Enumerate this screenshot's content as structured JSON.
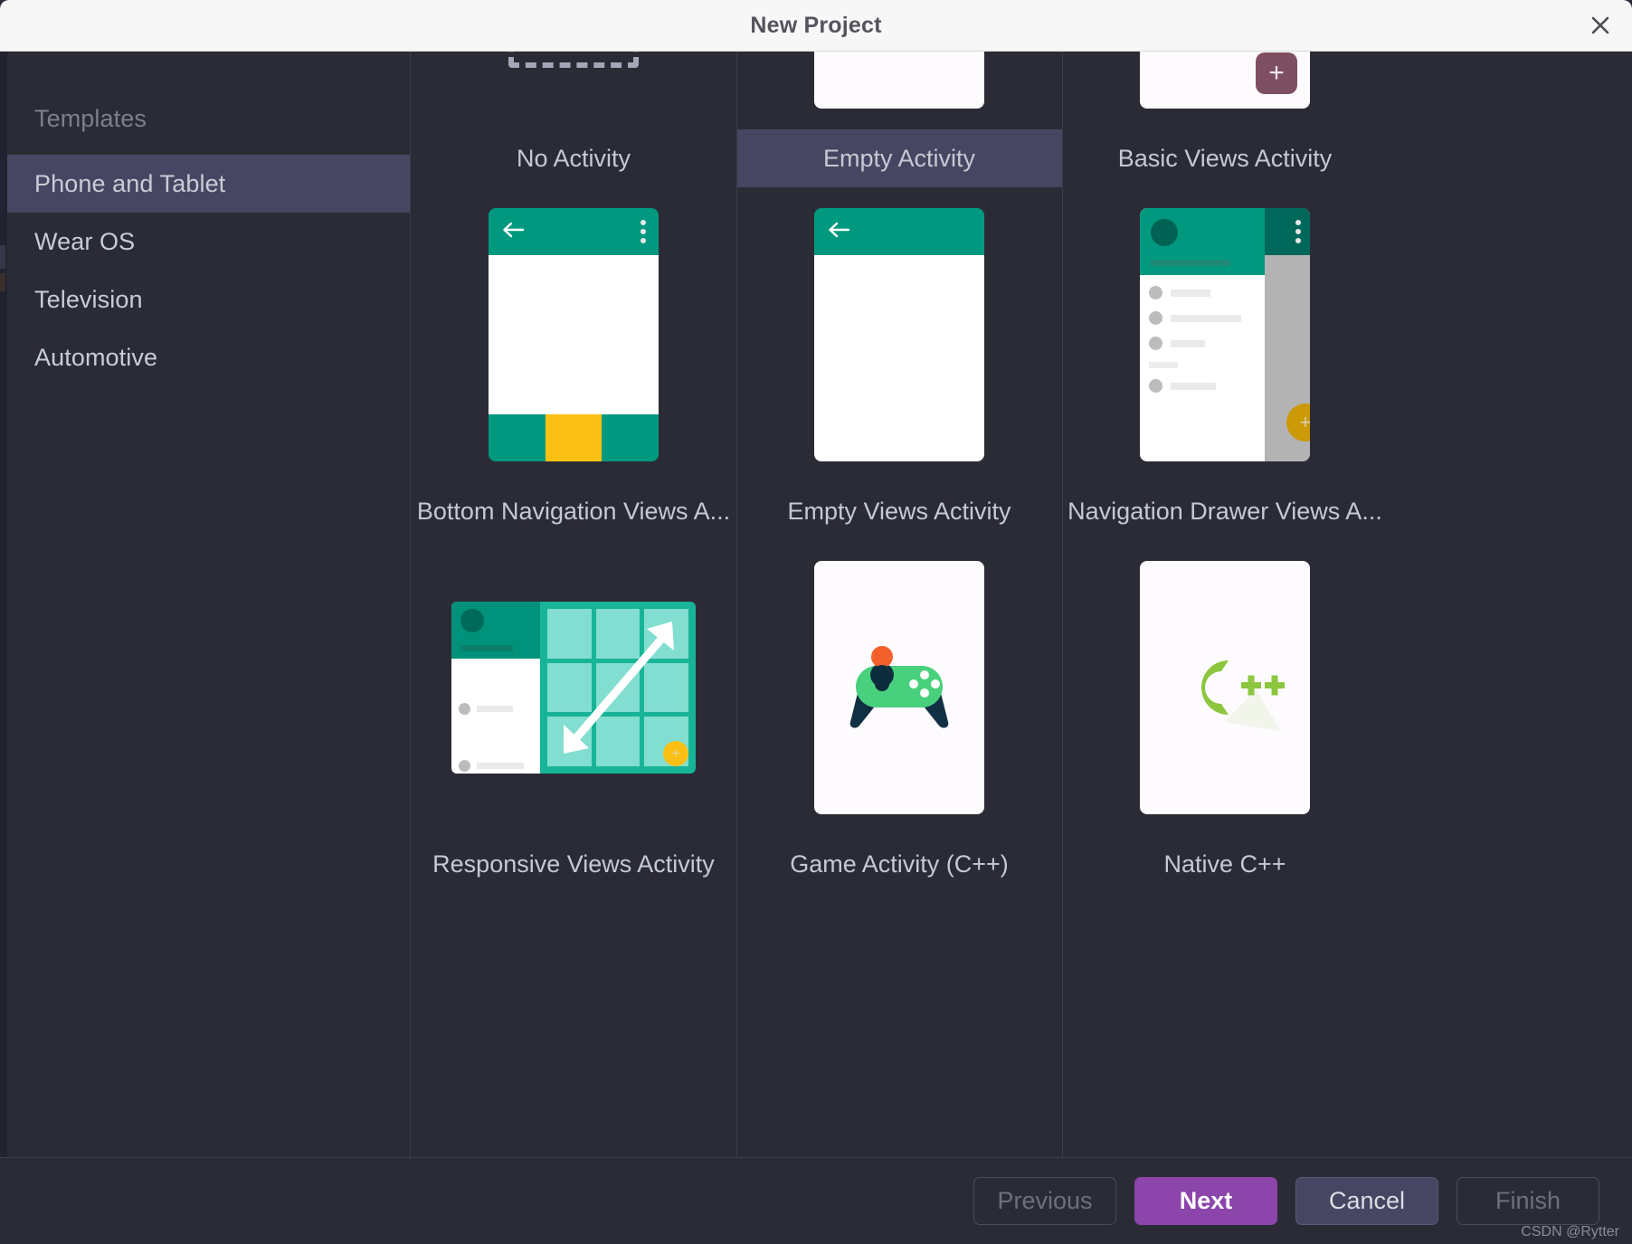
{
  "window": {
    "title": "New Project",
    "close_icon": "close-icon"
  },
  "sidebar": {
    "header": "Templates",
    "items": [
      {
        "label": "Phone and Tablet",
        "selected": true
      },
      {
        "label": "Wear OS",
        "selected": false
      },
      {
        "label": "Television",
        "selected": false
      },
      {
        "label": "Automotive",
        "selected": false
      }
    ]
  },
  "templates": [
    {
      "label": "No Activity",
      "icon": "dashed-rectangle-icon",
      "selected": false
    },
    {
      "label": "Empty Activity",
      "icon": "jetpack-compose-icon",
      "selected": true
    },
    {
      "label": "Basic Views Activity",
      "icon": "basic-views-thumbnail",
      "selected": false
    },
    {
      "label": "Bottom Navigation Views A...",
      "icon": "bottom-navigation-thumbnail",
      "selected": false
    },
    {
      "label": "Empty Views Activity",
      "icon": "empty-views-thumbnail",
      "selected": false
    },
    {
      "label": "Navigation Drawer Views A...",
      "icon": "navigation-drawer-thumbnail",
      "selected": false
    },
    {
      "label": "Responsive Views Activity",
      "icon": "responsive-views-thumbnail",
      "selected": false
    },
    {
      "label": "Game Activity (C++)",
      "icon": "gamepad-icon",
      "selected": false
    },
    {
      "label": "Native C++",
      "icon": "cpp-logo-icon",
      "selected": false
    }
  ],
  "footer": {
    "previous": "Previous",
    "next": "Next",
    "cancel": "Cancel",
    "finish": "Finish",
    "watermark": "CSDN @Rytter"
  },
  "colors": {
    "dialog_bg": "#2b2b36",
    "selection": "#474662",
    "primary_button": "#8b45ab",
    "teal": "#00997f",
    "amber": "#fcc014",
    "maroon_fab": "#7d4f61"
  }
}
